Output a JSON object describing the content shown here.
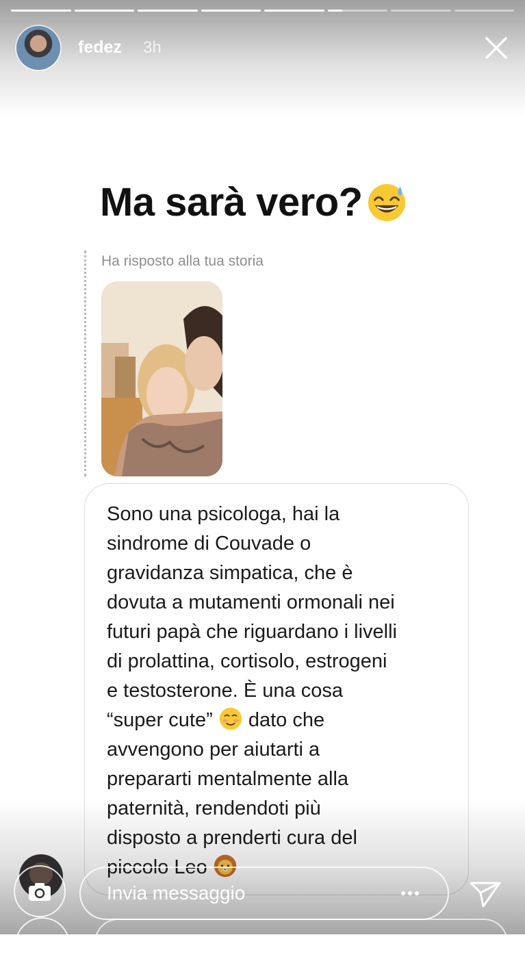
{
  "story": {
    "progress": [
      1,
      1,
      1,
      1,
      1,
      0.25,
      0,
      0
    ]
  },
  "header": {
    "username": "fedez",
    "time_ago": "3h"
  },
  "content": {
    "title": "Ma sarà vero?",
    "title_emoji": "grinning-sweat-emoji",
    "reply_label": "Ha risposto alla tua storia",
    "message": "Sono una psicologa, hai la\nsindrome di Couvade o\ngravidanza simpatica, che è\ndovuta a mutamenti ormonali nei\nfuturi papà che riguardano i livelli\ndi prolattina, cortisolo, estrogeni\ne testosterone. È una cosa\n“super cute”",
    "message_emoji_1": "smiling-blush-emoji",
    "message_cont": " dato che\navvengono per aiutarti a\nprepararti mentalmente alla\npaternità, rendendoti più\ndisposto a prenderti cura del\npiccolo Leo",
    "message_emoji_2": "lion-emoji"
  },
  "footer": {
    "input_placeholder": "Invia messaggio",
    "icons": [
      "camera-icon",
      "more-dots-icon",
      "send-icon"
    ]
  },
  "colors": {
    "text": "#1a1a1a",
    "label_gray": "#8e8e8e",
    "bubble_border": "#dbdbdb",
    "overlay_white": "#ffffff"
  }
}
